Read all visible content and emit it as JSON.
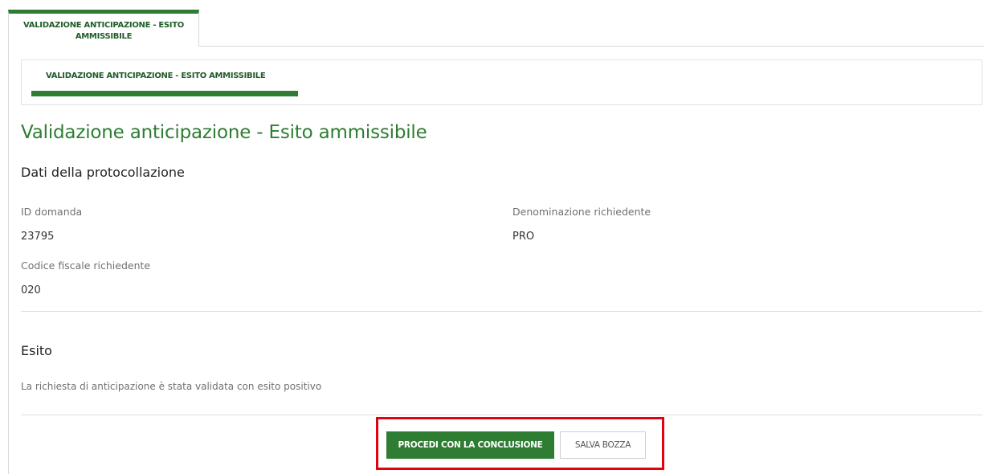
{
  "tabs": {
    "main_tab_label": "VALIDAZIONE ANTICIPAZIONE - ESITO AMMISSIBILE",
    "step_tab_label": "VALIDAZIONE ANTICIPAZIONE - ESITO AMMISSIBILE"
  },
  "page": {
    "title": "Validazione anticipazione - Esito ammissibile"
  },
  "protocollazione": {
    "section_title": "Dati della protocollazione",
    "fields": [
      {
        "label": "ID domanda",
        "value": "23795"
      },
      {
        "label": "Denominazione richiedente",
        "value": "PRO"
      },
      {
        "label": "Codice fiscale richiedente",
        "value": "020"
      }
    ]
  },
  "esito": {
    "section_title": "Esito",
    "message": "La richiesta di anticipazione è stata validata con esito positivo"
  },
  "actions": {
    "proceed_label": "PROCEDI CON LA CONCLUSIONE",
    "save_draft_label": "SALVA BOZZA"
  },
  "colors": {
    "accent": "#2e7d32",
    "highlight": "#e3000f"
  }
}
